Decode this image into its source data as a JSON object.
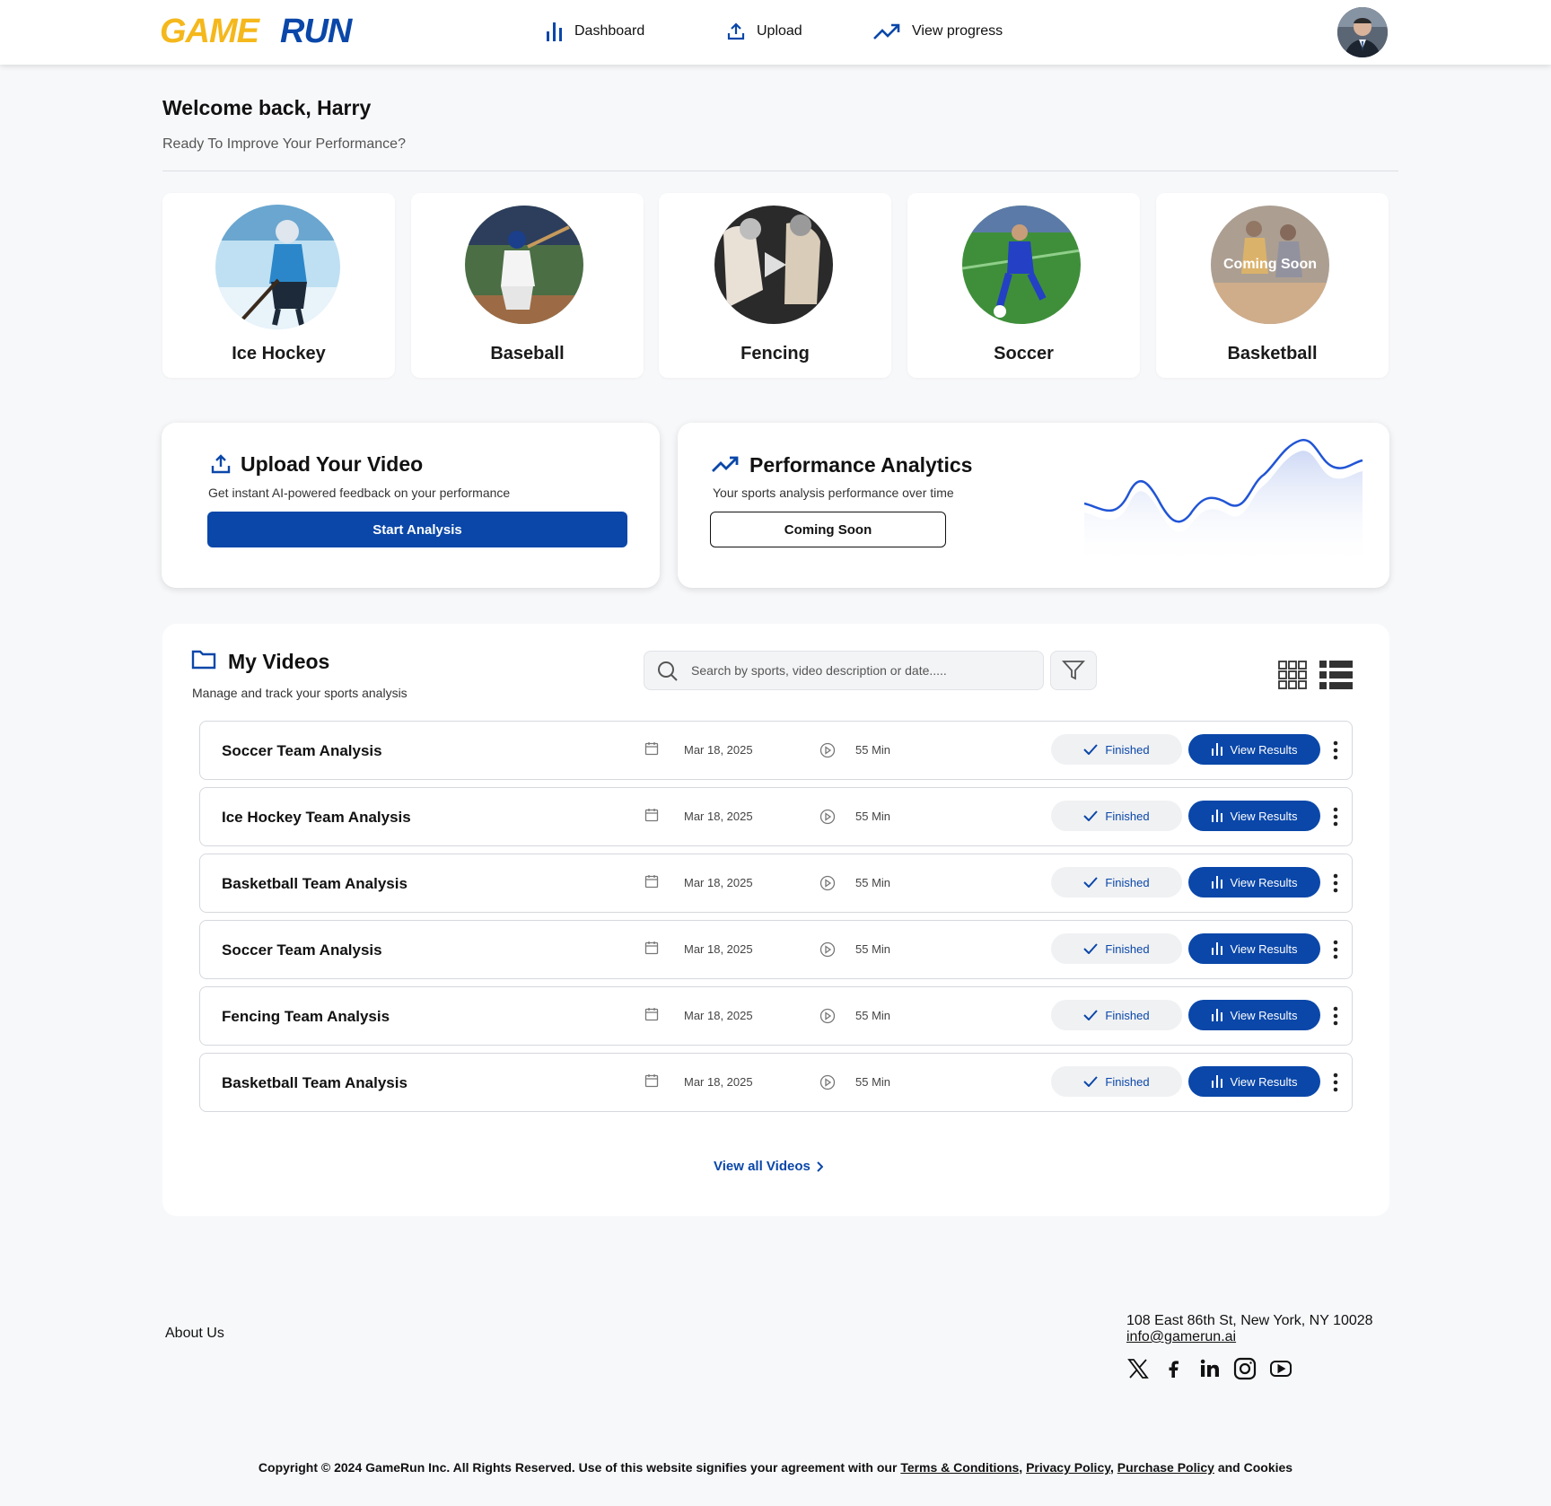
{
  "header": {
    "logo_text": "GAMERUN",
    "nav": [
      {
        "label": "Dashboard",
        "icon": "bar-chart-icon"
      },
      {
        "label": "Upload",
        "icon": "upload-icon"
      },
      {
        "label": "View progress",
        "icon": "trending-up-icon"
      }
    ]
  },
  "welcome": {
    "title": "Welcome back, Harry",
    "subtitle": "Ready To Improve Your Performance?"
  },
  "sports": [
    {
      "label": "Ice Hockey"
    },
    {
      "label": "Baseball"
    },
    {
      "label": "Fencing"
    },
    {
      "label": "Soccer"
    },
    {
      "label": "Basketball",
      "overlay": "Coming Soon"
    }
  ],
  "upload_card": {
    "title": "Upload Your Video",
    "subtitle": "Get instant AI-powered feedback on your performance",
    "button": "Start Analysis"
  },
  "analytics_card": {
    "title": "Performance Analytics",
    "subtitle": "Your sports analysis performance over time",
    "button": "Coming Soon"
  },
  "my_videos": {
    "title": "My Videos",
    "subtitle": "Manage and track your sports analysis",
    "search_placeholder": "Search by sports, video description or date.....",
    "view_all": "View all Videos",
    "rows": [
      {
        "title": "Soccer Team Analysis",
        "date": "Mar 18, 2025",
        "duration": "55 Min",
        "status": "Finished",
        "action": "View Results"
      },
      {
        "title": "Ice Hockey Team Analysis",
        "date": "Mar 18, 2025",
        "duration": "55 Min",
        "status": "Finished",
        "action": "View Results"
      },
      {
        "title": "Basketball Team Analysis",
        "date": "Mar 18, 2025",
        "duration": "55 Min",
        "status": "Finished",
        "action": "View Results"
      },
      {
        "title": "Soccer Team Analysis",
        "date": "Mar 18, 2025",
        "duration": "55 Min",
        "status": "Finished",
        "action": "View Results"
      },
      {
        "title": "Fencing Team Analysis",
        "date": "Mar 18, 2025",
        "duration": "55 Min",
        "status": "Finished",
        "action": "View Results"
      },
      {
        "title": "Basketball Team Analysis",
        "date": "Mar 18, 2025",
        "duration": "55 Min",
        "status": "Finished",
        "action": "View Results"
      }
    ]
  },
  "footer": {
    "about": "About Us",
    "address": "108 East 86th St, New York, NY 10028",
    "email": "info@gamerun.ai",
    "social": [
      "x-icon",
      "facebook-icon",
      "linkedin-icon",
      "instagram-icon",
      "youtube-icon"
    ],
    "copyright_prefix": "Copyright © 2024 GameRun Inc. All Rights Reserved. Use of this website signifies your agreement with our",
    "terms": "Terms & Conditions",
    "privacy": "Privacy Policy",
    "purchase": "Purchase Policy",
    "copyright_suffix": "and Cookies"
  },
  "colors": {
    "primary": "#0a47a9",
    "logo_yellow": "#f5b81c",
    "logo_blue": "#0a47a9",
    "chart_line": "#2155d6"
  }
}
